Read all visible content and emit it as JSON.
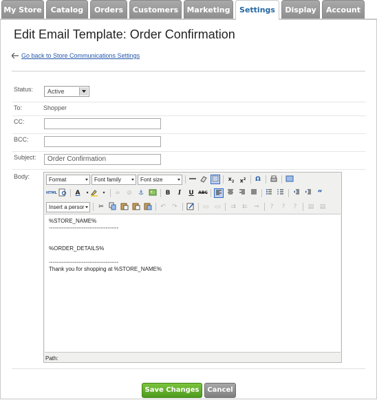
{
  "nav": {
    "tabs": [
      "My Store",
      "Catalog",
      "Orders",
      "Customers",
      "Marketing",
      "Settings",
      "Display",
      "Account"
    ],
    "active_tab": "Settings"
  },
  "page": {
    "title": "Edit Email Template: Order Confirmation",
    "back_link": "Go back to Store Communications Settings"
  },
  "form": {
    "status": {
      "label": "Status:",
      "value": "Active"
    },
    "to": {
      "label": "To:",
      "value": "Shopper"
    },
    "cc": {
      "label": "CC:",
      "value": ""
    },
    "bcc": {
      "label": "BCC:",
      "value": ""
    },
    "subject": {
      "label": "Subject:",
      "value": "Order Confirmation"
    },
    "body": {
      "label": "Body:"
    }
  },
  "editor": {
    "format_label": "Format",
    "font_family_label": "Font family",
    "font_size_label": "Font size",
    "insert_label": "Insert a persor",
    "content_lines": [
      "%STORE_NAME%",
      "--------------------------------------",
      "",
      "",
      "%ORDER_DETAILS%",
      "",
      "--------------------------------------",
      "Thank you for shopping at %STORE_NAME%"
    ],
    "status_bar": "Path:"
  },
  "actions": {
    "save_label": "Save Changes",
    "cancel_label": "Cancel"
  }
}
